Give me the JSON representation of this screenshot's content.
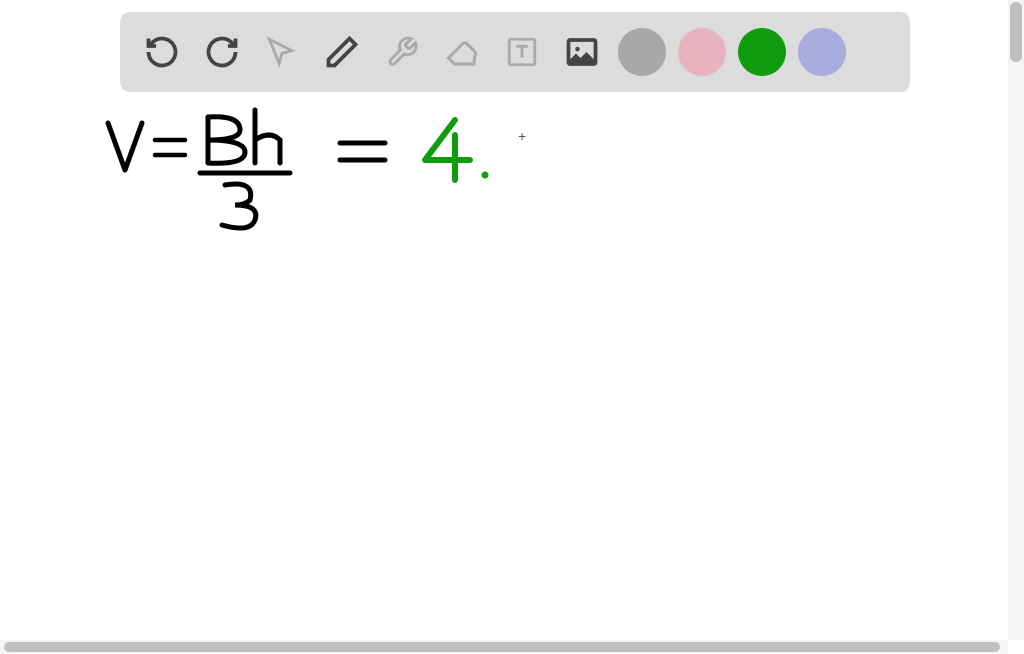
{
  "toolbar": {
    "tools": [
      {
        "name": "undo",
        "icon": "undo-icon",
        "enabled": true
      },
      {
        "name": "redo",
        "icon": "redo-icon",
        "enabled": true
      },
      {
        "name": "pointer",
        "icon": "pointer-icon",
        "enabled": false
      },
      {
        "name": "pencil",
        "icon": "pencil-icon",
        "enabled": true
      },
      {
        "name": "tools",
        "icon": "tools-icon",
        "enabled": false
      },
      {
        "name": "eraser",
        "icon": "eraser-icon",
        "enabled": false
      },
      {
        "name": "text",
        "icon": "text-icon",
        "enabled": false
      },
      {
        "name": "image",
        "icon": "image-icon",
        "enabled": true
      }
    ],
    "colors": [
      {
        "name": "gray",
        "hex": "#a8a8a8"
      },
      {
        "name": "pink",
        "hex": "#e8b3bf"
      },
      {
        "name": "green",
        "hex": "#0f9d0f"
      },
      {
        "name": "lavender",
        "hex": "#a8acdc"
      }
    ]
  },
  "canvas": {
    "equation": {
      "left_var": "V",
      "equals1": "=",
      "numerator": "Bh",
      "denominator": "3",
      "equals2": "=",
      "result": "4.",
      "result_color": "#0f9d0f",
      "main_color": "#000000"
    }
  }
}
